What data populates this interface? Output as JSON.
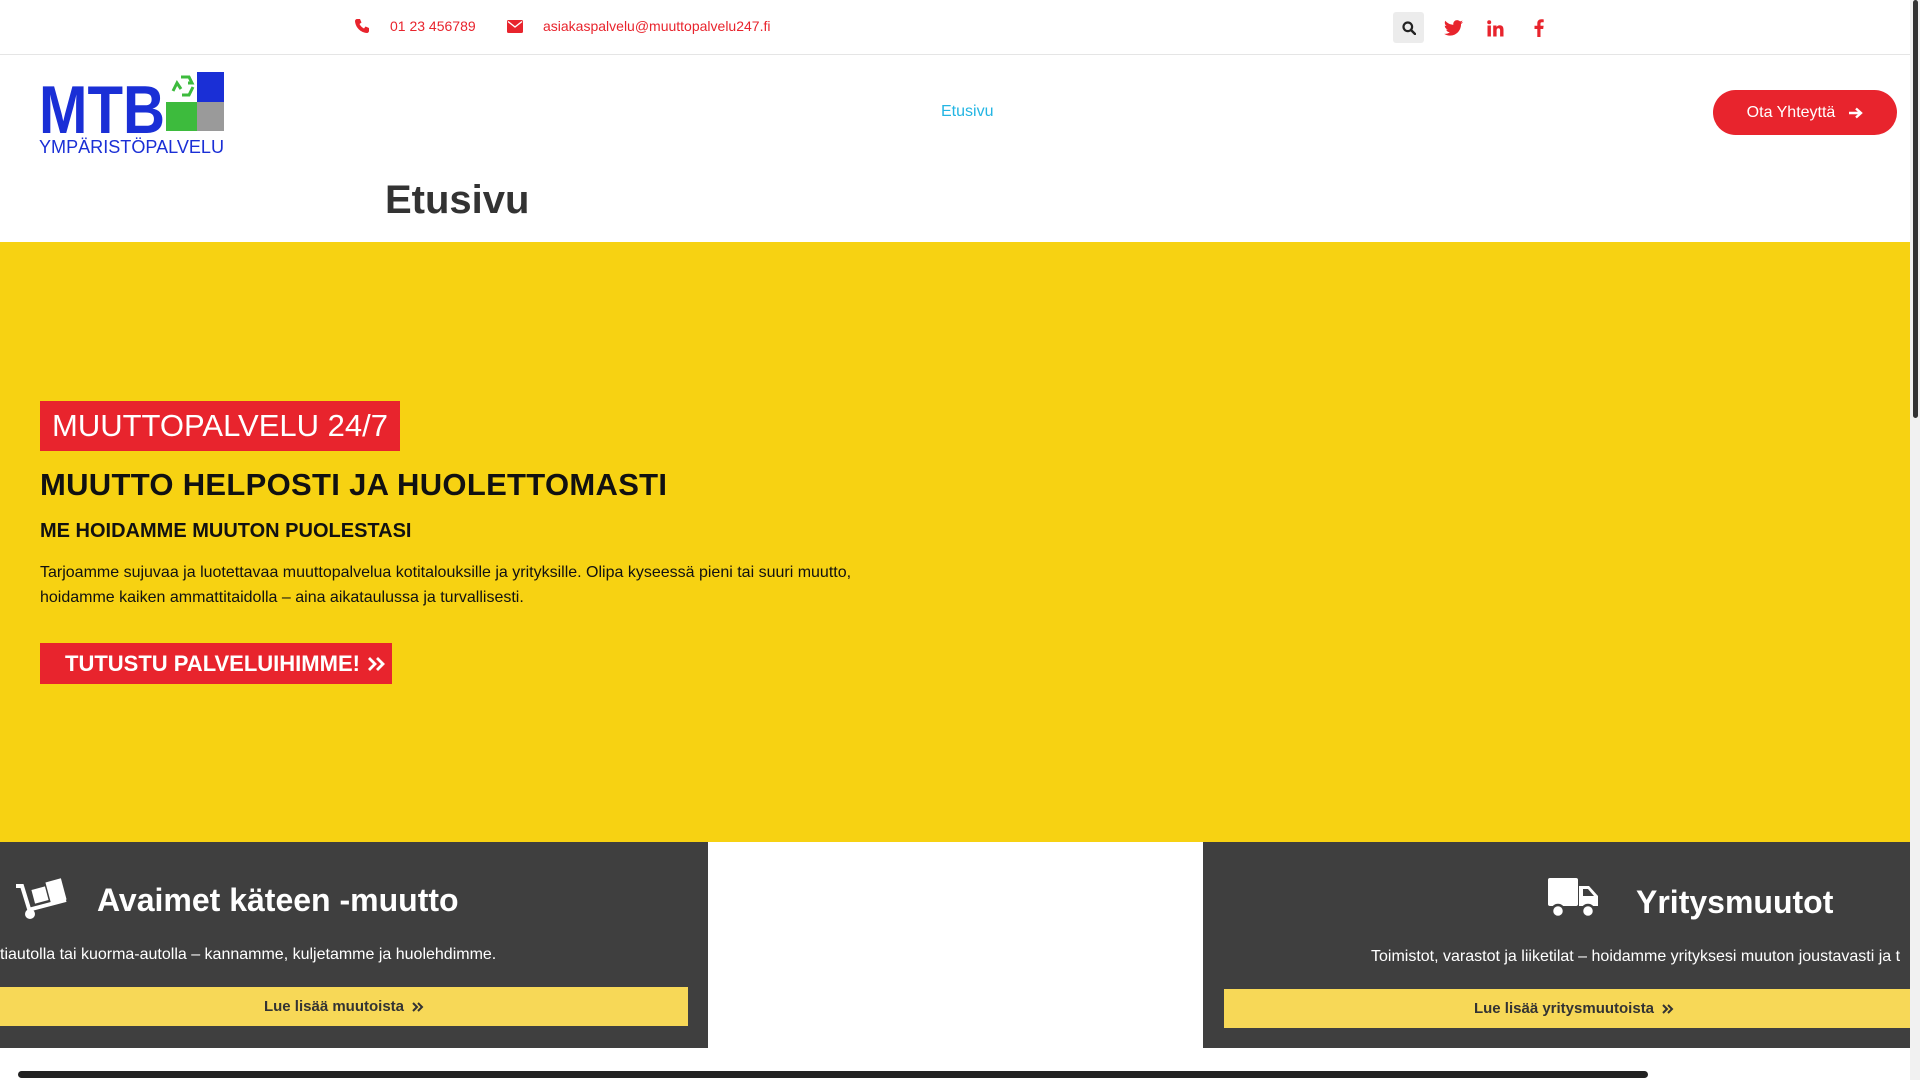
{
  "topbar": {
    "phone": "01 23 456789",
    "email": "asiakaspalvelu@muuttopalvelu247.fi",
    "icons": [
      "phone-icon",
      "envelope-icon",
      "search-icon",
      "twitter-icon",
      "linkedin-icon",
      "facebook-icon"
    ]
  },
  "header": {
    "logo_text": "MTB",
    "logo_subtitle": "YMPÄRISTÖPALVELU",
    "nav": {
      "home": "Etusivu"
    },
    "cta_label": "Ota Yhteyttä"
  },
  "page_title": "Etusivu",
  "hero": {
    "badge": "MUUTTOPALVELU 24/7",
    "heading": "MUUTTO HELPOSTI JA HUOLETTOMASTI",
    "subheading": "ME HOIDAMME MUUTON PUOLESTASI",
    "paragraph_line1": "Tarjoamme sujuvaa ja luotettavaa muuttopalvelua kotitalouksille ja yrityksille. Olipa kyseessä pieni tai suuri muutto,",
    "paragraph_line2": "hoidamme kaiken ammattitaidolla – aina aikataulussa ja turvallisesti.",
    "button_label": "TUTUSTU PALVELUIHIMME!"
  },
  "cards": [
    {
      "title": "Avaimet käteen -muutto",
      "text": "tiautolla tai kuorma-autolla – kannamme, kuljetamme ja huolehdimme.",
      "button_label": "Lue lisää muutoista",
      "icon": "dolly-icon"
    },
    {
      "title": "Yritysmuutot",
      "text": "Toimistot, varastot ja liiketilat – hoidamme yrityksesi muuton joustavasti ja t",
      "button_label": "Lue lisää yritysmuutoista",
      "icon": "truck-icon"
    }
  ],
  "colors": {
    "brand_red": "#e8242d",
    "hero_yellow": "#f7d212",
    "card_dark": "#3f3f3f",
    "card_button_yellow": "#f7d857",
    "nav_active": "#23b5e3",
    "logo_blue": "#1a2fd6",
    "logo_green": "#3dbb3d"
  }
}
